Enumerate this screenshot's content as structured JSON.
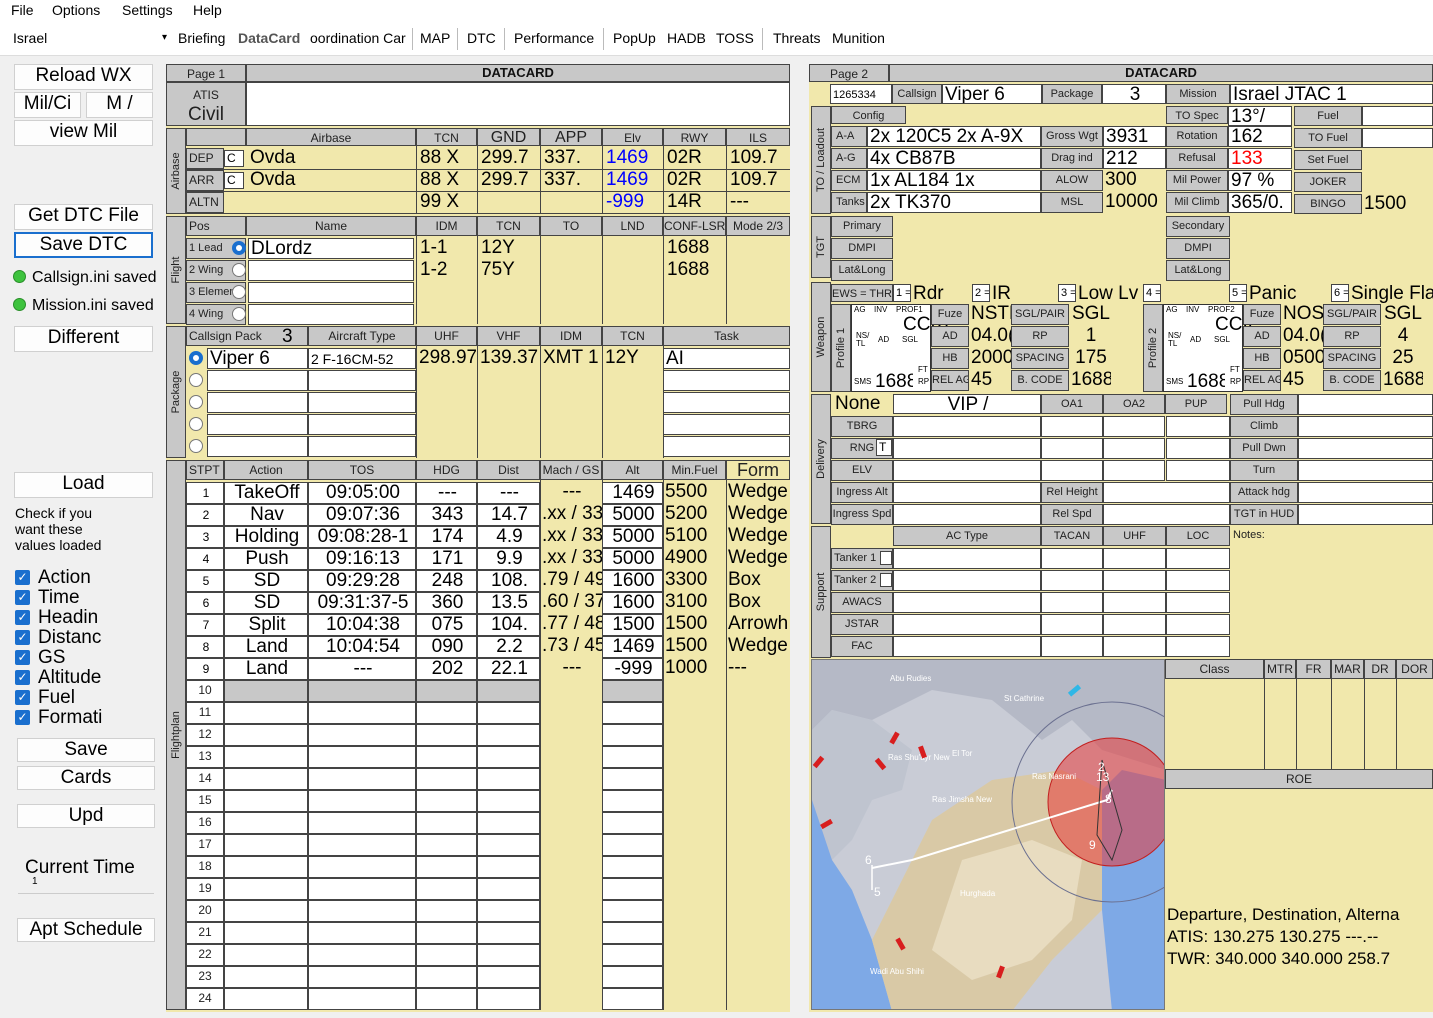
{
  "menu": [
    "File",
    "Options",
    "Settings",
    "Help"
  ],
  "theater": "Israel",
  "tabs": [
    "Briefing",
    "DataCard",
    "oordination Car",
    "MAP",
    "DTC",
    "Performance",
    "PopUp",
    "HADB",
    "TOSS",
    "Threats",
    "Munition"
  ],
  "sidebar": {
    "reload_wx": "Reload WX",
    "mil_ci": "Mil/Ci",
    "m_slash": "M /",
    "view_mil": "view Mil",
    "get_dtc": "Get DTC File",
    "save_dtc": "Save DTC",
    "callsign_saved": "Callsign.ini saved",
    "mission_saved": "Mission.ini saved",
    "different": "Different",
    "load": "Load",
    "check_text": [
      "Check if you",
      "want these",
      "values loaded"
    ],
    "checks": [
      "Action",
      "Time",
      "Headin",
      "Distanc",
      "GS",
      "Altitude",
      "Fuel",
      "Formati"
    ],
    "save": "Save",
    "cards": "Cards",
    "upd": "Upd",
    "current_time": "Current Time",
    "time_val": "1",
    "apt_schedule": "Apt Schedule"
  },
  "page1": {
    "page": "Page 1",
    "title": "DATACARD",
    "atis_lbl": "ATIS",
    "atis_val": "Civil",
    "airbase_side": "Airbase",
    "airbase_hdr": [
      "Airbase",
      "TCN",
      "GND",
      "APP",
      "Elv",
      "RWY",
      "ILS"
    ],
    "airbase_rows": [
      {
        "lbl": "DEP",
        "c": "C",
        "name": "Ovda",
        "tcn": "88 X",
        "gnd": "299.7",
        "app": "337.",
        "elv": "1469",
        "rwy": "02R",
        "ils": "109.7"
      },
      {
        "lbl": "ARR",
        "c": "C",
        "name": "Ovda",
        "tcn": "88 X",
        "gnd": "299.7",
        "app": "337.",
        "elv": "1469",
        "rwy": "02R",
        "ils": "109.7"
      },
      {
        "lbl": "ALTN",
        "c": "",
        "name": "",
        "tcn": "99 X",
        "gnd": "",
        "app": "",
        "elv": "-999",
        "rwy": "14R",
        "ils": "---"
      }
    ],
    "flight_side": "Flight",
    "flight_hdr": [
      "Pos",
      "Name",
      "IDM",
      "TCN",
      "TO",
      "LND",
      "CONF-LSR",
      "Mode 2/3"
    ],
    "flight_rows": [
      {
        "pos": "1 Lead",
        "name": "DLordz",
        "idm": "1-1",
        "tcn": "12Y",
        "conf": "1688"
      },
      {
        "pos": "2 Wing",
        "name": "",
        "idm": "1-2",
        "tcn": "75Y",
        "conf": "1688"
      },
      {
        "pos": "3 Elemen",
        "name": "",
        "idm": "",
        "tcn": "",
        "conf": ""
      },
      {
        "pos": "4 Wing",
        "name": "",
        "idm": "",
        "tcn": "",
        "conf": ""
      }
    ],
    "package_side": "Package",
    "package_hdr": [
      "Callsign Pack",
      "Aircraft Type",
      "UHF",
      "VHF",
      "IDM",
      "TCN",
      "Task"
    ],
    "package_num": "3",
    "package_row": {
      "callsign": "Viper 6",
      "ac": "2 F-16CM-52",
      "uhf": "298.97",
      "vhf": "139.37",
      "idm": "XMT 1",
      "tcn": "12Y",
      "task": "AI"
    },
    "fp_side": "Flightplan",
    "fp_hdr": [
      "STPT",
      "Action",
      "TOS",
      "HDG",
      "Dist",
      "Mach / GS",
      "Alt",
      "Min.Fuel",
      "Form"
    ],
    "fp_rows": [
      [
        "1",
        "TakeOff",
        "09:05:00",
        "---",
        "---",
        "---",
        "1469",
        "5500",
        "Wedge"
      ],
      [
        "2",
        "Nav",
        "09:07:36",
        "343",
        "14.7",
        ".xx / 33",
        "5000",
        "5200",
        "Wedge"
      ],
      [
        "3",
        "Holding",
        "09:08:28-1",
        "174",
        "4.9",
        ".xx / 33",
        "5000",
        "5100",
        "Wedge"
      ],
      [
        "4",
        "Push",
        "09:16:13",
        "171",
        "9.9",
        ".xx / 33",
        "5000",
        "4900",
        "Wedge"
      ],
      [
        "5",
        "SD",
        "09:29:28",
        "248",
        "108.",
        ".79 / 49",
        "1600",
        "3300",
        "Box"
      ],
      [
        "6",
        "SD",
        "09:31:37-5",
        "360",
        "13.5",
        ".60 / 37",
        "1600",
        "3100",
        "Box"
      ],
      [
        "7",
        "Split",
        "10:04:38",
        "075",
        "104.",
        ".77 / 48",
        "1500",
        "1500",
        "Arrowh"
      ],
      [
        "8",
        "Land",
        "10:04:54",
        "090",
        "2.2",
        ".73 / 45",
        "1469",
        "1500",
        "Wedge"
      ],
      [
        "9",
        "Land",
        "---",
        "202",
        "22.1",
        "---",
        "-999",
        "1000",
        "---"
      ]
    ],
    "fp_empty": [
      "10",
      "11",
      "12",
      "13",
      "14",
      "15",
      "16",
      "17",
      "18",
      "19",
      "20",
      "21",
      "22",
      "23",
      "24"
    ]
  },
  "page2": {
    "page": "Page 2",
    "title": "DATACARD",
    "id": "1265334",
    "callsign_lbl": "Callsign",
    "callsign": "Viper 6",
    "package_lbl": "Package",
    "package": "3",
    "mission_lbl": "Mission",
    "mission": "Israel  JTAC  1",
    "to_side": "TO / Loadout",
    "config_lbl": "Config",
    "loadout": [
      {
        "lbl": "A-A",
        "val": "2x 120C5 2x A-9X"
      },
      {
        "lbl": "A-G",
        "val": "4x CB87B"
      },
      {
        "lbl": "ECM",
        "val": "1x AL184 1x"
      },
      {
        "lbl": "Tanks",
        "val": "2x TK370"
      }
    ],
    "perf": [
      {
        "lbl": "Gross Wgt",
        "val": "3931"
      },
      {
        "lbl": "Drag ind",
        "val": "212"
      },
      {
        "lbl": "ALOW",
        "val": "300"
      },
      {
        "lbl": "MSL",
        "val": "10000"
      }
    ],
    "to_spec_lbl": "TO Spec",
    "to_spec": "13°/",
    "rot": [
      {
        "lbl": "Rotation",
        "val": "162"
      },
      {
        "lbl": "Refusal",
        "val": "133"
      },
      {
        "lbl": "Mil Power",
        "val": "97 %"
      },
      {
        "lbl": "Mil Climb",
        "val": "365/0."
      }
    ],
    "fuel_lbl": [
      "Fuel",
      "TO Fuel",
      "Set Fuel",
      "JOKER",
      "BINGO"
    ],
    "bingo": "1500",
    "tgt_side": "TGT",
    "tgt_rows": [
      "Primary",
      "DMPI",
      "Lat&Long"
    ],
    "tgt_rows2": [
      "Secondary",
      "DMPI",
      "Lat&Long"
    ],
    "weapon_side": "Weapon",
    "ews_lbl": "EWS = THR",
    "ews": [
      {
        "n": "1 =",
        "v": "Rdr"
      },
      {
        "n": "2 =",
        "v": "IR"
      },
      {
        "n": "3 =",
        "v": "Low Lv"
      },
      {
        "n": "4 =",
        "v": ""
      },
      {
        "n": "5 =",
        "v": "Panic"
      },
      {
        "n": "6 =",
        "v": "Single Fla"
      }
    ],
    "profile1": {
      "side": "Profile 1",
      "mode": "CCRP",
      "prof": "PROF1",
      "fuze": "NSTL",
      "ad": "04.0(",
      "hb": "2000",
      "rel": "45",
      "sgl": "SGL",
      "rp": "1",
      "spacing": "175",
      "bcode": "1688",
      "sms": "1688",
      "fuze_lbl": "Fuze",
      "ad_lbl": "AD",
      "hb_lbl": "HB",
      "rel_lbl": "REL AGL",
      "sgl_lbl": "SGL/PAIR",
      "rp_lbl": "RP",
      "sp_lbl": "SPACING",
      "bc_lbl": "B. CODE"
    },
    "profile2": {
      "side": "Profile 2",
      "mode": "CCIP",
      "prof": "PROF2",
      "fuze": "NOS",
      "ad": "04.0(",
      "hb": "0500",
      "rel": "45",
      "sgl": "SGL",
      "rp": "4",
      "spacing": "25",
      "bcode": "1688",
      "sms": "1688",
      "fuze_lbl": "Fuze",
      "ad_lbl": "AD",
      "hb_lbl": "HB",
      "rel_lbl": "REL AGL",
      "sgl_lbl": "SGL/PAIR",
      "rp_lbl": "RP",
      "sp_lbl": "SPACING",
      "bc_lbl": "B. CODE"
    },
    "delivery_side": "Delivery",
    "delivery_none": "None",
    "delivery_vip": "VIP /",
    "delivery_hdr": [
      "OA1",
      "OA2",
      "PUP"
    ],
    "delivery_left": [
      "TBRG",
      "RNG",
      "ELV",
      "Ingress Alt",
      "Ingress Spd"
    ],
    "rng_val": "T",
    "delivery_mid": [
      "Rel Height",
      "Rel Spd"
    ],
    "delivery_right": [
      "Pull Hdg",
      "Climb",
      "Pull Dwn",
      "Turn",
      "Attack hdg",
      "TGT in HUD"
    ],
    "support_side": "Support",
    "support_hdr": [
      "AC Type",
      "TACAN",
      "UHF",
      "LOC",
      "Notes:"
    ],
    "support_rows": [
      "Tanker 1",
      "Tanker 2",
      "AWACS",
      "JSTAR",
      "FAC"
    ],
    "threat_hdr": [
      "Class",
      "MTR",
      "FR",
      "MAR",
      "DR",
      "DOR"
    ],
    "roe": "ROE",
    "notes": [
      "Departure, Destination, Alterna",
      "ATIS: 130.275  130.275  ---.--",
      "TWR: 340.000  340.000  258.7"
    ],
    "map_labels": [
      "Abu Rudies",
      "St Cathrine",
      "Ras Shu'ayr New",
      "El Tor",
      "Ras Nasrani",
      "Ras Jimsha New",
      "Hurghada",
      "Wadi Abu Shihi"
    ],
    "map_waypoints": [
      "2",
      "13",
      "8",
      "9",
      "6",
      "5"
    ]
  },
  "colors": {
    "panel": "#f1e8ac",
    "header": "#c8c8c8",
    "accent": "#1a6fce",
    "threat": "#e83a3a",
    "elv": "#0000ff",
    "refusal": "#ff0000"
  }
}
